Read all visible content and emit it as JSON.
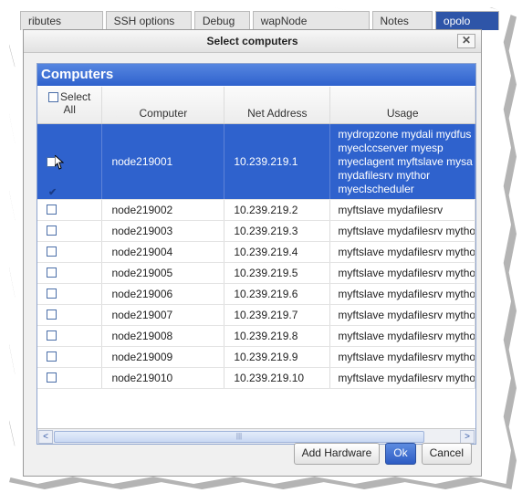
{
  "background_tabs": [
    "ributes",
    "SSH options",
    "Debug",
    "wapNode",
    "Notes",
    "opolo"
  ],
  "dialog": {
    "title": "Select computers",
    "close_glyph": "✕"
  },
  "panel": {
    "title": "Computers",
    "columns": {
      "select_all_top": "Select",
      "select_all_bottom": "All",
      "computer": "Computer",
      "net_address": "Net Address",
      "usage": "Usage"
    },
    "rows": [
      {
        "computer": "node219001",
        "address": "10.239.219.1",
        "usage": "mydropzone mydali mydfus myeclccserver myesp myeclagent myftslave mysa mydafilesrv mythor myeclscheduler",
        "checked": true,
        "selected": true
      },
      {
        "computer": "node219002",
        "address": "10.239.219.2",
        "usage": "myftslave mydafilesrv",
        "checked": false,
        "selected": false
      },
      {
        "computer": "node219003",
        "address": "10.239.219.3",
        "usage": "myftslave mydafilesrv mytho",
        "checked": false,
        "selected": false
      },
      {
        "computer": "node219004",
        "address": "10.239.219.4",
        "usage": "myftslave mydafilesrv mytho",
        "checked": false,
        "selected": false
      },
      {
        "computer": "node219005",
        "address": "10.239.219.5",
        "usage": "myftslave mydafilesrv mytho",
        "checked": false,
        "selected": false
      },
      {
        "computer": "node219006",
        "address": "10.239.219.6",
        "usage": "myftslave mydafilesrv mytho",
        "checked": false,
        "selected": false
      },
      {
        "computer": "node219007",
        "address": "10.239.219.7",
        "usage": "myftslave mydafilesrv mytho",
        "checked": false,
        "selected": false
      },
      {
        "computer": "node219008",
        "address": "10.239.219.8",
        "usage": "myftslave mydafilesrv mytho",
        "checked": false,
        "selected": false
      },
      {
        "computer": "node219009",
        "address": "10.239.219.9",
        "usage": "myftslave mydafilesrv mytho",
        "checked": false,
        "selected": false
      },
      {
        "computer": "node219010",
        "address": "10.239.219.10",
        "usage": "myftslave mydafilesrv mytho",
        "checked": false,
        "selected": false
      }
    ],
    "scrollbar": {
      "left_arrow": "<",
      "right_arrow": ">",
      "grip": "|||"
    }
  },
  "buttons": {
    "add_hardware": "Add Hardware",
    "ok": "Ok",
    "cancel": "Cancel"
  },
  "colors": {
    "accent": "#2f62cd",
    "header_blue": "#3a6ad6"
  }
}
